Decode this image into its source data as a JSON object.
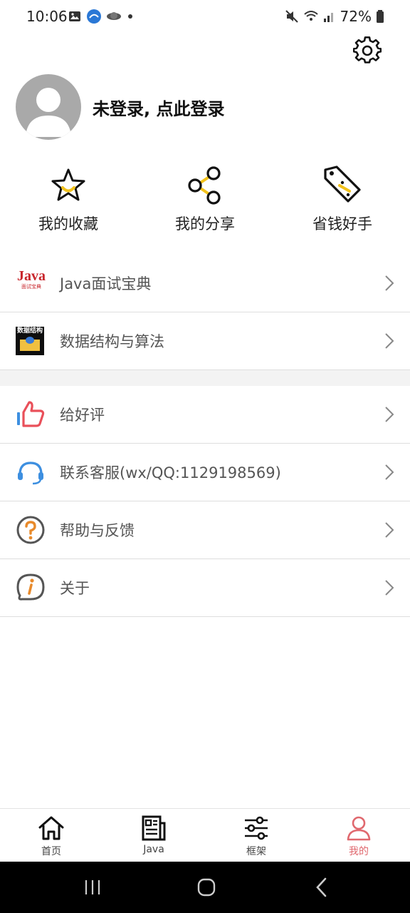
{
  "status_bar": {
    "time": "10:06",
    "battery": "72%"
  },
  "profile": {
    "login_prompt": "未登录, 点此登录"
  },
  "shortcuts": [
    {
      "label": "我的收藏",
      "icon": "star-icon"
    },
    {
      "label": "我的分享",
      "icon": "share-icon"
    },
    {
      "label": "省钱好手",
      "icon": "price-tag-icon"
    }
  ],
  "list_group_1": [
    {
      "label": "Java面试宝典",
      "icon": "java-book-icon",
      "icon_text": "Java",
      "icon_subtext": "面试宝典"
    },
    {
      "label": "数据结构与算法",
      "icon": "data-structure-book-icon",
      "icon_text": "数据结构"
    }
  ],
  "list_group_2": [
    {
      "label": "给好评",
      "icon": "thumbs-up-icon"
    },
    {
      "label": "联系客服(wx/QQ:1129198569)",
      "icon": "headset-icon"
    },
    {
      "label": "帮助与反馈",
      "icon": "help-icon"
    },
    {
      "label": "关于",
      "icon": "info-icon"
    }
  ],
  "bottom_nav": [
    {
      "label": "首页",
      "icon": "home-icon",
      "active": false
    },
    {
      "label": "Java",
      "icon": "news-icon",
      "active": false
    },
    {
      "label": "框架",
      "icon": "sliders-icon",
      "active": false
    },
    {
      "label": "我的",
      "icon": "person-icon",
      "active": true
    }
  ],
  "colors": {
    "accent": "#e0686e",
    "star_yellow": "#f2c21b",
    "thumb_red": "#e9505a",
    "headset_blue": "#3d8fe0",
    "help_orange": "#e88a2b"
  }
}
